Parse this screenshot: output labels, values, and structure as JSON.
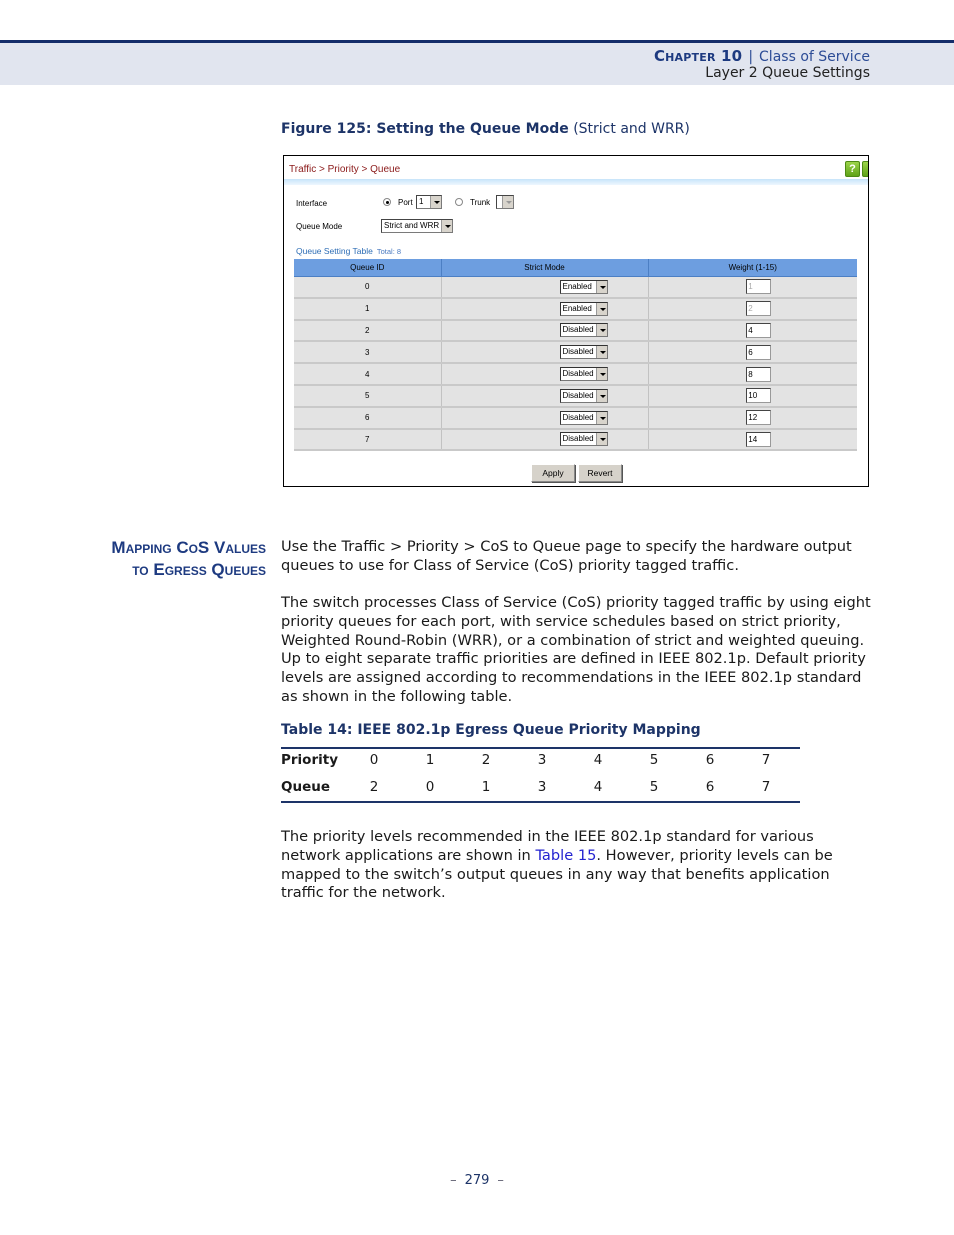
{
  "header": {
    "chapter_label": "Chapter 10",
    "separator": "|",
    "chapter_title": "Class of Service",
    "section_title": "Layer 2 Queue Settings",
    "band_color": "#e1e5ef",
    "rule_color": "#142d6a"
  },
  "figure": {
    "number_title": "Figure 125:  Setting the Queue Mode",
    "subtitle": " (Strict and WRR)"
  },
  "screenshot": {
    "breadcrumb": "Traffic > Priority > Queue",
    "help_icon": "help-question-icon",
    "interface_label": "Interface",
    "port_radio_label": "Port",
    "port_selected": true,
    "port_value": "1",
    "trunk_radio_label": "Trunk",
    "trunk_selected": false,
    "trunk_value": "",
    "queue_mode_label": "Queue Mode",
    "queue_mode_value": "Strict and WRR",
    "table_title": "Queue Setting Table",
    "table_total": "Total: 8",
    "columns": [
      "Queue ID",
      "Strict Mode",
      "Weight (1-15)"
    ],
    "rows": [
      {
        "queue_id": "0",
        "strict_mode": "Enabled",
        "weight": "1",
        "weight_disabled": true
      },
      {
        "queue_id": "1",
        "strict_mode": "Enabled",
        "weight": "2",
        "weight_disabled": true
      },
      {
        "queue_id": "2",
        "strict_mode": "Disabled",
        "weight": "4",
        "weight_disabled": false
      },
      {
        "queue_id": "3",
        "strict_mode": "Disabled",
        "weight": "6",
        "weight_disabled": false
      },
      {
        "queue_id": "4",
        "strict_mode": "Disabled",
        "weight": "8",
        "weight_disabled": false
      },
      {
        "queue_id": "5",
        "strict_mode": "Disabled",
        "weight": "10",
        "weight_disabled": false
      },
      {
        "queue_id": "6",
        "strict_mode": "Disabled",
        "weight": "12",
        "weight_disabled": false
      },
      {
        "queue_id": "7",
        "strict_mode": "Disabled",
        "weight": "14",
        "weight_disabled": false
      }
    ],
    "apply_label": "Apply",
    "revert_label": "Revert",
    "header_color": "#6d9ee0",
    "breadcrumb_color": "#8b1a1a"
  },
  "section": {
    "heading_line1": "Mapping CoS Values",
    "heading_line2": "to Egress Queues",
    "para1": "Use the Traffic > Priority > CoS to Queue page to specify the hardware output queues to use for Class of Service (CoS) priority tagged traffic.",
    "para2": "The switch processes Class of Service (CoS) priority tagged traffic by using eight priority queues for each port, with service schedules based on strict priority, Weighted Round-Robin (WRR), or a combination of strict and weighted queuing. Up to eight separate traffic priorities are defined in IEEE 802.1p. Default priority levels are assigned according to recommendations in the IEEE 802.1p standard as shown in the following table.",
    "table_caption": "Table 14: IEEE 802.1p Egress Queue Priority Mapping",
    "mapping": {
      "row_labels": [
        "Priority",
        "Queue"
      ],
      "priority": [
        "0",
        "1",
        "2",
        "3",
        "4",
        "5",
        "6",
        "7"
      ],
      "queue": [
        "2",
        "0",
        "1",
        "3",
        "4",
        "5",
        "6",
        "7"
      ]
    },
    "para3_before": "The priority levels recommended in the IEEE 802.1p standard for various network applications are shown in ",
    "para3_link": "Table 15",
    "para3_after": ". However, priority levels can be mapped to the switch’s output queues in any way that benefits application traffic for the network.",
    "heading_color": "#1d3a80",
    "link_color": "#2323d0"
  },
  "footer": {
    "dash_left": "–",
    "page_number": "279",
    "dash_right": "–"
  }
}
